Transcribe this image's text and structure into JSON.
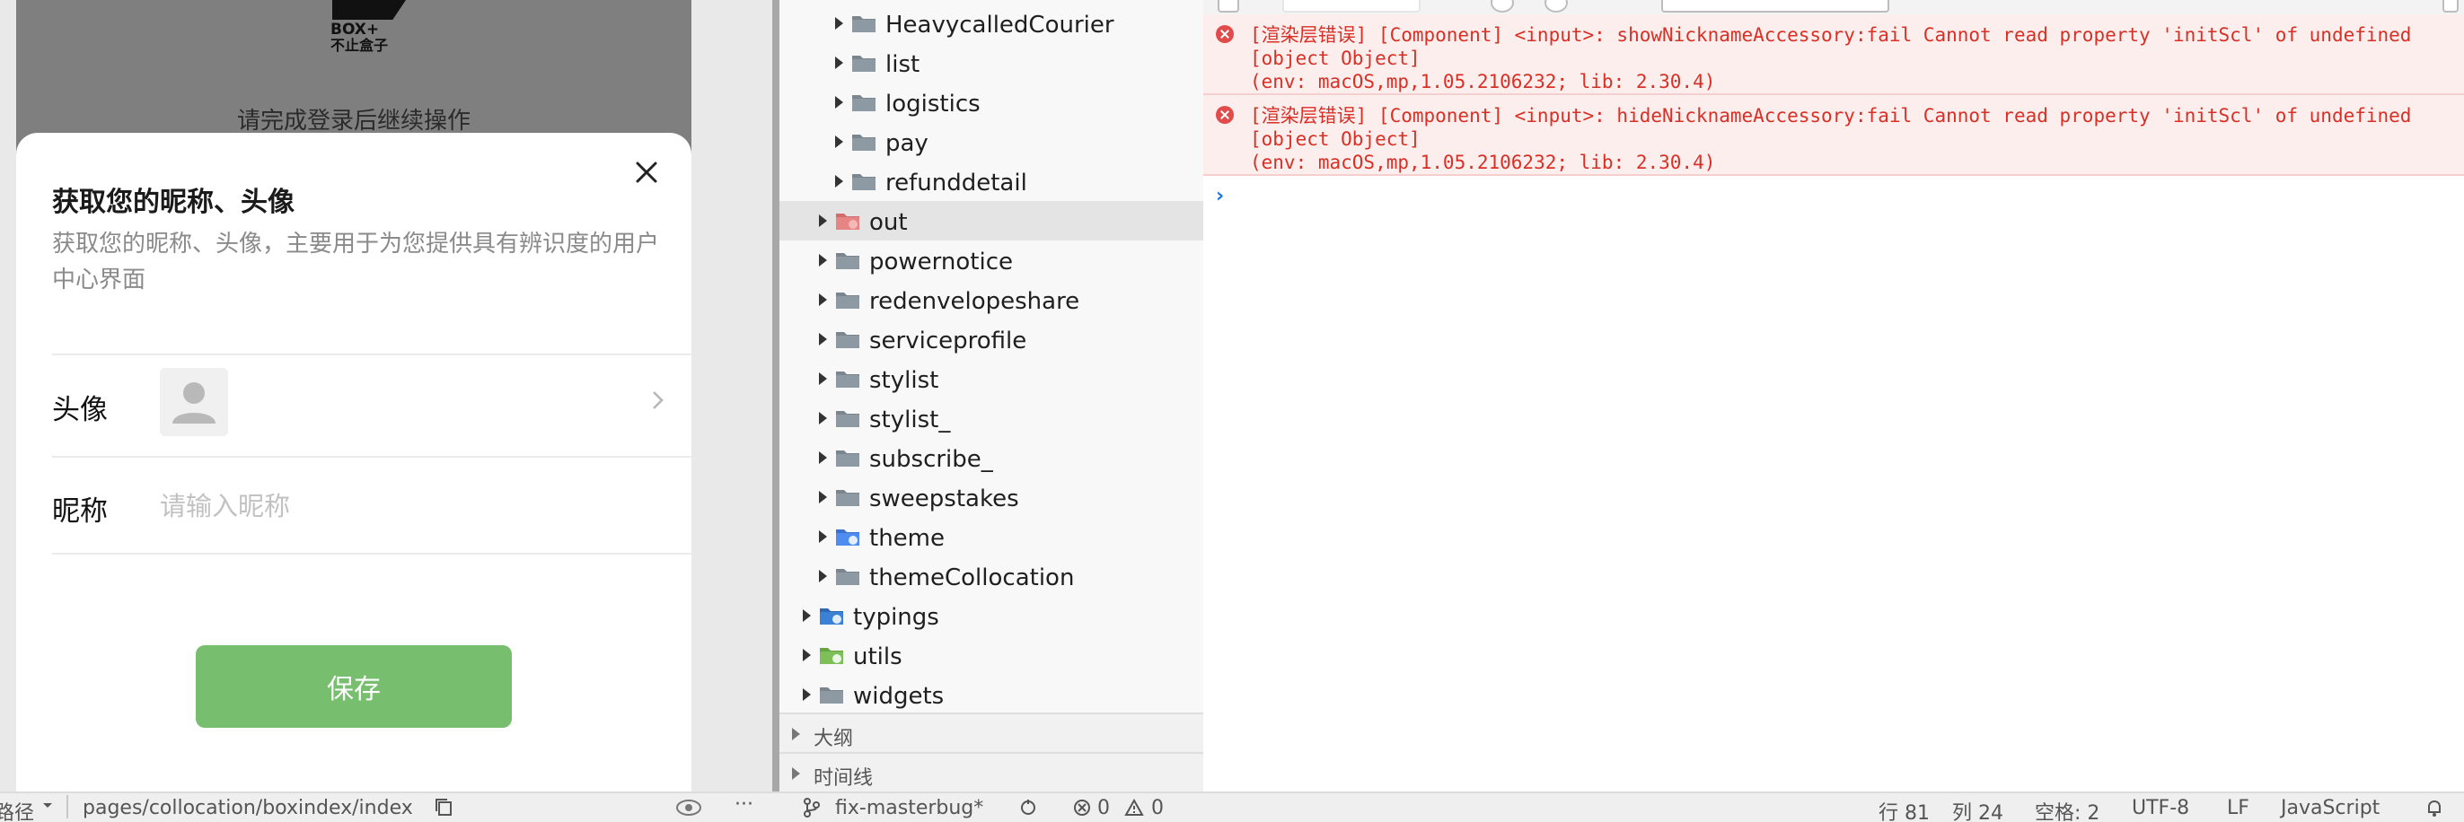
{
  "simulator": {
    "logo_line1": "BOX+",
    "logo_line2": "不止盒子",
    "login_tip": "请完成登录后继续操作",
    "sheet": {
      "title": "获取您的昵称、头像",
      "description": "获取您的昵称、头像，主要用于为您提供具有辨识度的用户中心界面",
      "avatar_label": "头像",
      "nickname_label": "昵称",
      "nickname_value": "",
      "nickname_placeholder": "请输入昵称",
      "save_label": "保存"
    }
  },
  "explorer": {
    "items": [
      {
        "label": "HeavycalledCourier",
        "icon": "folder-icon"
      },
      {
        "label": "list",
        "icon": "folder-icon"
      },
      {
        "label": "logistics",
        "icon": "folder-icon"
      },
      {
        "label": "pay",
        "icon": "folder-icon"
      },
      {
        "label": "refunddetail",
        "icon": "folder-icon"
      },
      {
        "label": "out",
        "icon": "folder-output-icon"
      },
      {
        "label": "powernotice",
        "icon": "folder-icon"
      },
      {
        "label": "redenvelopeshare",
        "icon": "folder-icon"
      },
      {
        "label": "serviceprofile",
        "icon": "folder-icon"
      },
      {
        "label": "stylist",
        "icon": "folder-icon"
      },
      {
        "label": "stylist_",
        "icon": "folder-icon"
      },
      {
        "label": "subscribe_",
        "icon": "folder-icon"
      },
      {
        "label": "sweepstakes",
        "icon": "folder-icon"
      },
      {
        "label": "theme",
        "icon": "folder-theme-icon"
      },
      {
        "label": "themeCollocation",
        "icon": "folder-icon"
      },
      {
        "label": "typings",
        "icon": "folder-typescript-icon"
      },
      {
        "label": "utils",
        "icon": "folder-utils-icon"
      },
      {
        "label": "widgets",
        "icon": "folder-icon"
      }
    ],
    "outline_label": "大纲",
    "timeline_label": "时间线"
  },
  "console": {
    "messages": [
      {
        "level": "error",
        "text": "[渲染层错误] [Component] <input>: showNicknameAccessory:fail Cannot read property 'initScl' of undefined [object Object]\n(env: macOS,mp,1.05.2106232; lib: 2.30.4)"
      },
      {
        "level": "error",
        "text": "[渲染层错误] [Component] <input>: hideNicknameAccessory:fail Cannot read property 'initScl' of undefined [object Object]\n(env: macOS,mp,1.05.2106232; lib: 2.30.4)"
      }
    ],
    "prompt_symbol": "›",
    "input_value": ""
  },
  "statusbar": {
    "path_prefix": "路径",
    "page_path": "pages/collocation/boxindex/index",
    "branch": "fix-masterbug*",
    "errors": "0",
    "warnings": "0",
    "line": "行 81",
    "column": "列 24",
    "spaces": "空格: 2",
    "encoding": "UTF-8",
    "eol": "LF",
    "language": "JavaScript"
  },
  "colors": {
    "save_button": "#77bf6e",
    "error_text": "#d93025",
    "error_bg": "#fdeeee",
    "prompt": "#1a73e8"
  }
}
